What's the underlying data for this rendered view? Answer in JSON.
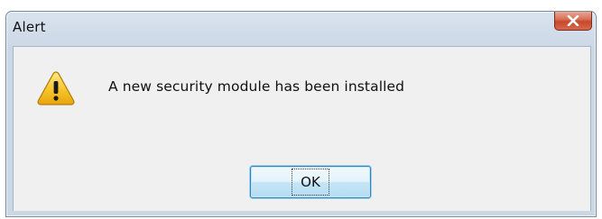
{
  "window": {
    "title": "Alert",
    "close_icon": "close-icon"
  },
  "body": {
    "icon": "warning-icon",
    "message": "A new security module has been installed"
  },
  "buttons": {
    "ok_label": "OK"
  },
  "colors": {
    "close_button": "#c8462c",
    "ok_button_border": "#3c7fb1",
    "client_background": "#f0f0f0",
    "frame_background": "#cfdbe8"
  }
}
